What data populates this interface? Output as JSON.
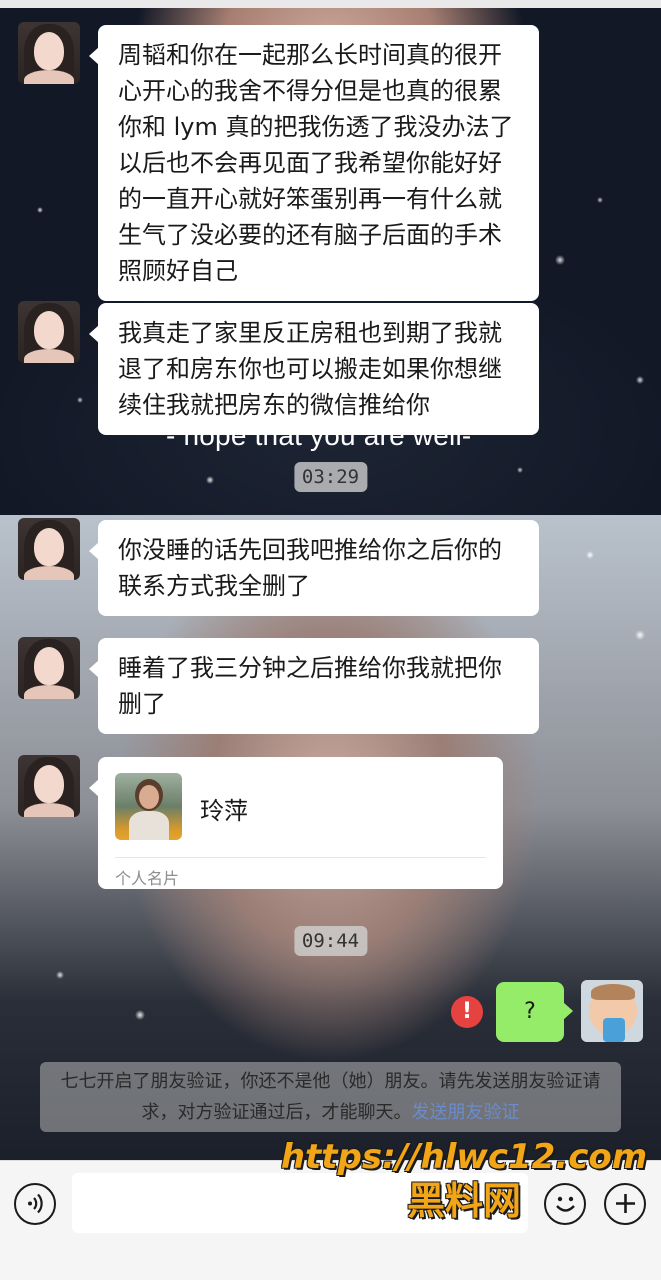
{
  "messages": [
    {
      "text": "周韬和你在一起那么长时间真的很开\n心开心的我舍不得分但是也真的很累\n你和 lym 真的把我伤透了我没办法了\n以后也不会再见面了我希望你能好好\n的一直开心就好笨蛋别再一有什么就\n生气了没必要的还有脑子后面的手术\n照顾好自己"
    },
    {
      "text": "我真走了家里反正房租也到期了我就\n退了和房东你也可以搬走如果你想继\n续住我就把房东的微信推给你"
    },
    {
      "text": "你没睡的话先回我吧推给你之后你的\n联系方式我全删了"
    },
    {
      "text": "睡着了我三分钟之后推给你我就把你\n删了"
    }
  ],
  "timestamps": {
    "first": "03:29",
    "second": "09:44"
  },
  "caption": "- hope that you are well-",
  "contact_card": {
    "name": "玲萍",
    "label": "个人名片"
  },
  "my_message": {
    "text": "?",
    "error_icon": "!"
  },
  "system_notice": {
    "text": "七七开启了朋友验证，你还不是他（她）朋友。请先发送朋友验证请求，对方验证通过后，才能聊天。",
    "link": "发送朋友验证"
  },
  "input_bar": {
    "voice_icon": "voice-icon",
    "emoji_icon": "emoji-icon",
    "plus_icon": "plus-icon"
  },
  "watermark": {
    "url": "https://hlwc12.com",
    "name": "黑料网"
  },
  "colors": {
    "my_bubble": "#95ec69",
    "error": "#e64340",
    "link": "#6b8cc9",
    "watermark": "#f2a516"
  }
}
